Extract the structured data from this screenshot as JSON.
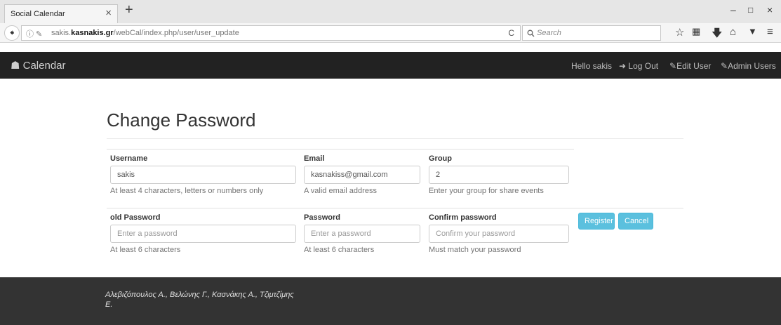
{
  "browser": {
    "tab_title": "Social Calendar",
    "tab_close": "×",
    "new_tab": "+",
    "win_min": "–",
    "win_restore": "🗗",
    "win_close": "×",
    "back": "◀",
    "info_icons": "ⓘ ✎",
    "url_host_prefix": "sakis.",
    "url_host_bold": "kasnakis.gr",
    "url_path": "/webCal/index.php/user/user_update",
    "reload": "C",
    "search_icon": "🔍",
    "search_placeholder": "Search",
    "toolbar_icons": [
      "star-icon",
      "reading-list-icon",
      "download-icon",
      "home-icon",
      "pocket-icon",
      "menu-icon"
    ]
  },
  "nav": {
    "brand": "Calendar",
    "brand_icon": "home-icon",
    "greeting": "Hello sakis",
    "logout": "Log Out",
    "edit_user": "Edit User",
    "admin_users": "Admin Users"
  },
  "form": {
    "title": "Change Password",
    "username": {
      "label": "Username",
      "value": "sakis",
      "help": "At least 4 characters, letters or numbers only"
    },
    "email": {
      "label": "Email",
      "value": "kasnakiss@gmail.com",
      "help": "A valid email address"
    },
    "group": {
      "label": "Group",
      "value": "2",
      "help": "Enter your group for share events"
    },
    "old_password": {
      "label": "old Password",
      "placeholder": "Enter a password",
      "help": "At least 6 characters"
    },
    "password": {
      "label": "Password",
      "placeholder": "Enter a password",
      "help": "At least 6 characters"
    },
    "confirm": {
      "label": "Confirm password",
      "placeholder": "Confirm your password",
      "help": "Must match your password"
    },
    "register_label": "Register",
    "cancel_label": "Cancel"
  },
  "footer": {
    "text": "Αλεβιζόπουλος Α., Βελώνης Γ., Κασνάκης Α., Τζιμτζίμης Ε."
  },
  "colors": {
    "navbar_bg": "#222222",
    "footer_bg": "#333333",
    "button_info": "#5bc0de"
  }
}
